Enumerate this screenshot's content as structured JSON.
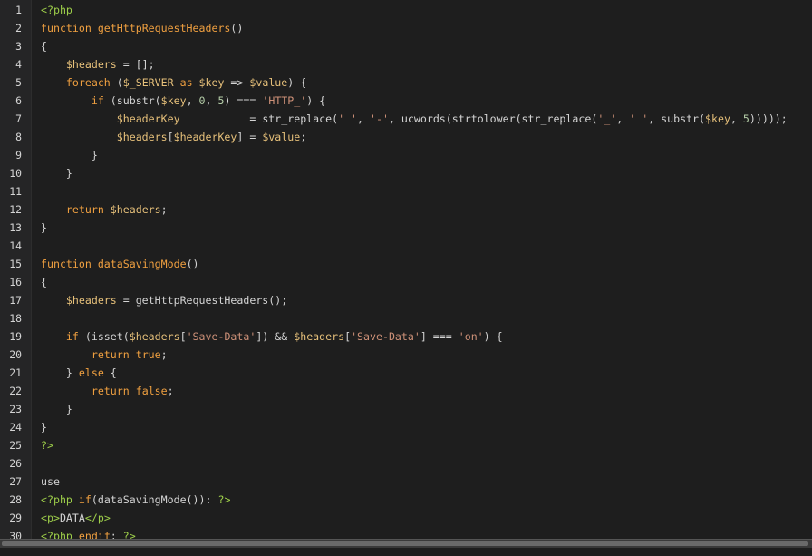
{
  "lines": [
    {
      "n": "1",
      "tokens": [
        {
          "c": "t-tag",
          "t": "<?php"
        }
      ]
    },
    {
      "n": "2",
      "tokens": [
        {
          "c": "t-kw",
          "t": "function "
        },
        {
          "c": "t-fname",
          "t": "getHttpRequestHeaders"
        },
        {
          "c": "t-plain",
          "t": "()"
        }
      ]
    },
    {
      "n": "3",
      "tokens": [
        {
          "c": "t-plain",
          "t": "{"
        }
      ]
    },
    {
      "n": "4",
      "tokens": [
        {
          "c": "t-plain",
          "t": "    "
        },
        {
          "c": "t-var",
          "t": "$headers"
        },
        {
          "c": "t-plain",
          "t": " = [];"
        }
      ]
    },
    {
      "n": "5",
      "tokens": [
        {
          "c": "t-plain",
          "t": "    "
        },
        {
          "c": "t-kw",
          "t": "foreach"
        },
        {
          "c": "t-plain",
          "t": " ("
        },
        {
          "c": "t-var",
          "t": "$_SERVER"
        },
        {
          "c": "t-kw",
          "t": " as "
        },
        {
          "c": "t-var",
          "t": "$key"
        },
        {
          "c": "t-plain",
          "t": " => "
        },
        {
          "c": "t-var",
          "t": "$value"
        },
        {
          "c": "t-plain",
          "t": ") {"
        }
      ]
    },
    {
      "n": "6",
      "tokens": [
        {
          "c": "t-plain",
          "t": "        "
        },
        {
          "c": "t-kw",
          "t": "if"
        },
        {
          "c": "t-plain",
          "t": " (substr("
        },
        {
          "c": "t-var",
          "t": "$key"
        },
        {
          "c": "t-plain",
          "t": ", "
        },
        {
          "c": "t-num",
          "t": "0"
        },
        {
          "c": "t-plain",
          "t": ", "
        },
        {
          "c": "t-num",
          "t": "5"
        },
        {
          "c": "t-plain",
          "t": ") === "
        },
        {
          "c": "t-str",
          "t": "'HTTP_'"
        },
        {
          "c": "t-plain",
          "t": ") {"
        }
      ]
    },
    {
      "n": "7",
      "tokens": [
        {
          "c": "t-plain",
          "t": "            "
        },
        {
          "c": "t-var",
          "t": "$headerKey"
        },
        {
          "c": "t-plain",
          "t": "           = str_replace("
        },
        {
          "c": "t-str",
          "t": "' '"
        },
        {
          "c": "t-plain",
          "t": ", "
        },
        {
          "c": "t-str",
          "t": "'-'"
        },
        {
          "c": "t-plain",
          "t": ", ucwords(strtolower(str_replace("
        },
        {
          "c": "t-str",
          "t": "'_'"
        },
        {
          "c": "t-plain",
          "t": ", "
        },
        {
          "c": "t-str",
          "t": "' '"
        },
        {
          "c": "t-plain",
          "t": ", substr("
        },
        {
          "c": "t-var",
          "t": "$key"
        },
        {
          "c": "t-plain",
          "t": ", "
        },
        {
          "c": "t-num",
          "t": "5"
        },
        {
          "c": "t-plain",
          "t": ")))));"
        }
      ]
    },
    {
      "n": "8",
      "tokens": [
        {
          "c": "t-plain",
          "t": "            "
        },
        {
          "c": "t-var",
          "t": "$headers"
        },
        {
          "c": "t-plain",
          "t": "["
        },
        {
          "c": "t-var",
          "t": "$headerKey"
        },
        {
          "c": "t-plain",
          "t": "] = "
        },
        {
          "c": "t-var",
          "t": "$value"
        },
        {
          "c": "t-plain",
          "t": ";"
        }
      ]
    },
    {
      "n": "9",
      "tokens": [
        {
          "c": "t-plain",
          "t": "        }"
        }
      ]
    },
    {
      "n": "10",
      "tokens": [
        {
          "c": "t-plain",
          "t": "    }"
        }
      ]
    },
    {
      "n": "11",
      "tokens": []
    },
    {
      "n": "12",
      "tokens": [
        {
          "c": "t-plain",
          "t": "    "
        },
        {
          "c": "t-kw",
          "t": "return"
        },
        {
          "c": "t-plain",
          "t": " "
        },
        {
          "c": "t-var",
          "t": "$headers"
        },
        {
          "c": "t-plain",
          "t": ";"
        }
      ]
    },
    {
      "n": "13",
      "tokens": [
        {
          "c": "t-plain",
          "t": "}"
        }
      ]
    },
    {
      "n": "14",
      "tokens": []
    },
    {
      "n": "15",
      "tokens": [
        {
          "c": "t-kw",
          "t": "function "
        },
        {
          "c": "t-fname",
          "t": "dataSavingMode"
        },
        {
          "c": "t-plain",
          "t": "()"
        }
      ]
    },
    {
      "n": "16",
      "tokens": [
        {
          "c": "t-plain",
          "t": "{"
        }
      ]
    },
    {
      "n": "17",
      "tokens": [
        {
          "c": "t-plain",
          "t": "    "
        },
        {
          "c": "t-var",
          "t": "$headers"
        },
        {
          "c": "t-plain",
          "t": " = getHttpRequestHeaders();"
        }
      ]
    },
    {
      "n": "18",
      "tokens": []
    },
    {
      "n": "19",
      "tokens": [
        {
          "c": "t-plain",
          "t": "    "
        },
        {
          "c": "t-kw",
          "t": "if"
        },
        {
          "c": "t-plain",
          "t": " (isset("
        },
        {
          "c": "t-var",
          "t": "$headers"
        },
        {
          "c": "t-plain",
          "t": "["
        },
        {
          "c": "t-str",
          "t": "'Save-Data'"
        },
        {
          "c": "t-plain",
          "t": "]) && "
        },
        {
          "c": "t-var",
          "t": "$headers"
        },
        {
          "c": "t-plain",
          "t": "["
        },
        {
          "c": "t-str",
          "t": "'Save-Data'"
        },
        {
          "c": "t-plain",
          "t": "] === "
        },
        {
          "c": "t-str",
          "t": "'on'"
        },
        {
          "c": "t-plain",
          "t": ") {"
        }
      ]
    },
    {
      "n": "20",
      "tokens": [
        {
          "c": "t-plain",
          "t": "        "
        },
        {
          "c": "t-kw",
          "t": "return"
        },
        {
          "c": "t-plain",
          "t": " "
        },
        {
          "c": "t-bool",
          "t": "true"
        },
        {
          "c": "t-plain",
          "t": ";"
        }
      ]
    },
    {
      "n": "21",
      "tokens": [
        {
          "c": "t-plain",
          "t": "    } "
        },
        {
          "c": "t-kw",
          "t": "else"
        },
        {
          "c": "t-plain",
          "t": " {"
        }
      ]
    },
    {
      "n": "22",
      "tokens": [
        {
          "c": "t-plain",
          "t": "        "
        },
        {
          "c": "t-kw",
          "t": "return"
        },
        {
          "c": "t-plain",
          "t": " "
        },
        {
          "c": "t-bool",
          "t": "false"
        },
        {
          "c": "t-plain",
          "t": ";"
        }
      ]
    },
    {
      "n": "23",
      "tokens": [
        {
          "c": "t-plain",
          "t": "    }"
        }
      ]
    },
    {
      "n": "24",
      "tokens": [
        {
          "c": "t-plain",
          "t": "}"
        }
      ]
    },
    {
      "n": "25",
      "tokens": [
        {
          "c": "t-tag",
          "t": "?>"
        }
      ]
    },
    {
      "n": "26",
      "tokens": []
    },
    {
      "n": "27",
      "tokens": [
        {
          "c": "t-plain",
          "t": "use"
        }
      ]
    },
    {
      "n": "28",
      "tokens": [
        {
          "c": "t-tag",
          "t": "<?php"
        },
        {
          "c": "t-plain",
          "t": " "
        },
        {
          "c": "t-kw",
          "t": "if"
        },
        {
          "c": "t-plain",
          "t": "(dataSavingMode()): "
        },
        {
          "c": "t-tag",
          "t": "?>"
        }
      ]
    },
    {
      "n": "29",
      "tokens": [
        {
          "c": "t-tag",
          "t": "<p>"
        },
        {
          "c": "t-plain",
          "t": "DATA"
        },
        {
          "c": "t-tag",
          "t": "</p>"
        }
      ]
    },
    {
      "n": "30",
      "tokens": [
        {
          "c": "t-tag",
          "t": "<?php"
        },
        {
          "c": "t-plain",
          "t": " "
        },
        {
          "c": "t-kw",
          "t": "endif"
        },
        {
          "c": "t-plain",
          "t": "; "
        },
        {
          "c": "t-tag",
          "t": "?>"
        }
      ]
    }
  ]
}
